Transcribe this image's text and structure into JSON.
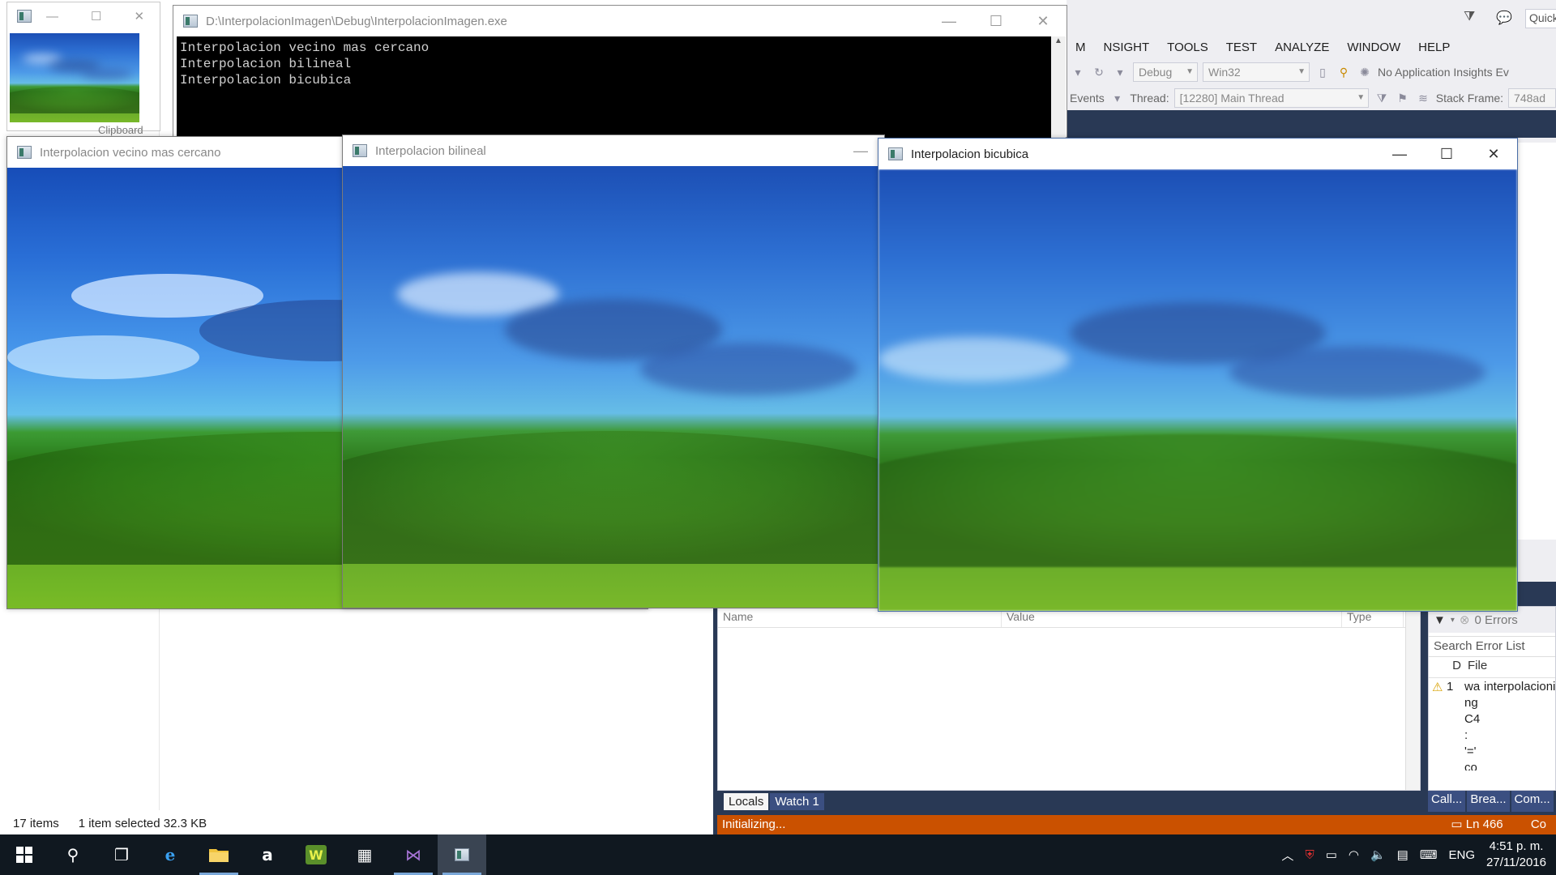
{
  "visual_studio": {
    "menus": [
      "M",
      "NSIGHT",
      "TOOLS",
      "TEST",
      "ANALYZE",
      "WINDOW",
      "HELP"
    ],
    "quick_launch": "Quick",
    "config": "Debug",
    "platform": "Win32",
    "insights": "No Application Insights Ev",
    "events_label": "Events",
    "thread_label": "Thread:",
    "thread_value": "[12280] Main Thread",
    "stack_frame_label": "Stack Frame:",
    "stack_frame_value": "748ad",
    "locals": {
      "columns": [
        "Name",
        "Value",
        "Type"
      ],
      "tabs": [
        "Locals",
        "Watch 1"
      ]
    },
    "error_list": {
      "errors": "0 Errors",
      "search": "Search Error List",
      "col_d": "D",
      "col_file": "File",
      "row_num": "1",
      "row_text": [
        "wa",
        "ng",
        "C4",
        ":",
        "'='",
        "co"
      ],
      "row_file": "interpolacioni",
      "tabs": [
        "Call...",
        "Brea...",
        "Com..."
      ]
    },
    "status": "Initializing...",
    "status_line": "Ln 466",
    "status_col": "Co"
  },
  "explorer": {
    "items_count": "17 items",
    "selected": "1 item selected  32.3 KB",
    "clipboard_label": "Clipboard"
  },
  "console": {
    "title": "D:\\InterpolacionImagen\\Debug\\InterpolacionImagen.exe",
    "lines": "Interpolacion vecino mas cercano\nInterpolacion bilineal\nInterpolacion bicubica"
  },
  "windows": {
    "nearest": "Interpolacion vecino mas cercano",
    "bilinear": "Interpolacion bilineal",
    "bicubic": "Interpolacion bicubica"
  },
  "taskbar": {
    "language": "ENG",
    "time": "4:51 p. m.",
    "date": "27/11/2016"
  },
  "colors": {
    "vs_status": "#ca5100",
    "vs_dark": "#293955",
    "taskbar": "#101820"
  }
}
